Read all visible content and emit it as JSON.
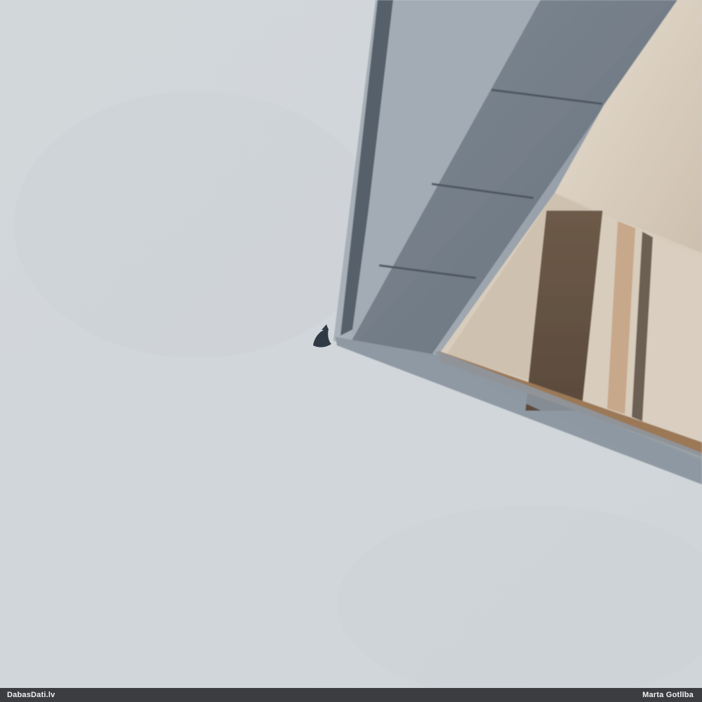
{
  "footer": {
    "site_label": "DabasDati.lv",
    "author_label": "Marta Gotlība"
  },
  "colors": {
    "sky": "#d3d8dc",
    "metal_light": "#9ea7b0",
    "metal_mid": "#7e8893",
    "metal_dark": "#4f5863",
    "wood_light": "#d7cfc0",
    "wood_mid": "#b9a896",
    "wood_dark": "#7a5e43",
    "footer_bg": "#3b3d40"
  },
  "subject": {
    "bird_icon": "bird-icon"
  }
}
